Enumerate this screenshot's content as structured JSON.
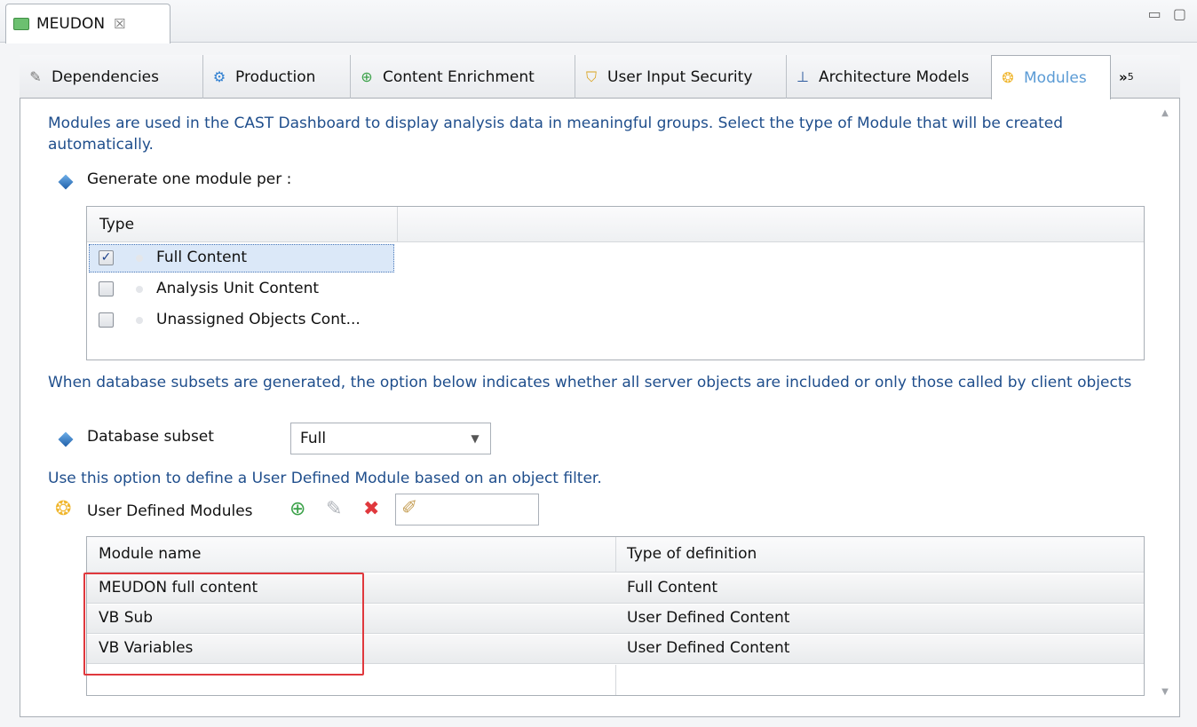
{
  "editor": {
    "title": "MEUDON",
    "close_glyph": "☒",
    "window_controls": "▭ ▢"
  },
  "tabs": [
    {
      "label": "Dependencies",
      "icon": "dependencies-icon",
      "glyph": "✎"
    },
    {
      "label": "Production",
      "icon": "production-icon",
      "glyph": "⚙"
    },
    {
      "label": "Content Enrichment",
      "icon": "content-enrichment-icon",
      "glyph": "⊕"
    },
    {
      "label": "User Input Security",
      "icon": "shield-icon",
      "glyph": "⛉"
    },
    {
      "label": "Architecture Models",
      "icon": "architecture-icon",
      "glyph": "⊥"
    },
    {
      "label": "Modules",
      "icon": "modules-icon",
      "glyph": "❂",
      "active": true
    }
  ],
  "tabs_overflow": {
    "label": "»",
    "count": "5"
  },
  "modules_intro": "Modules are used in the CAST Dashboard to display analysis data in meaningful groups. Select the type of Module that will be created automatically.",
  "generate": {
    "label": "Generate one module per :",
    "column_header": "Type",
    "rows": [
      {
        "label": "Full Content",
        "checked": true
      },
      {
        "label": "Analysis Unit Content",
        "checked": false
      },
      {
        "label": "Unassigned Objects Cont...",
        "checked": false
      }
    ]
  },
  "subset_intro": "When database subsets are generated, the option below indicates whether all server objects are included or only those called by client objects",
  "database_subset": {
    "label": "Database subset",
    "value": "Full"
  },
  "udm_intro": "Use this option to define a User Defined Module based on an object filter.",
  "udm": {
    "label": "User Defined Modules",
    "filter_value": "",
    "columns": [
      "Module name",
      "Type of definition"
    ],
    "rows": [
      {
        "name": "MEUDON full content",
        "type": "Full Content"
      },
      {
        "name": "VB Sub",
        "type": "User Defined Content"
      },
      {
        "name": "VB Variables",
        "type": "User Defined Content"
      }
    ]
  },
  "colors": {
    "accent": "#5b9bd5",
    "intro_text": "#1f4e8c",
    "highlight": "#e0383d"
  }
}
